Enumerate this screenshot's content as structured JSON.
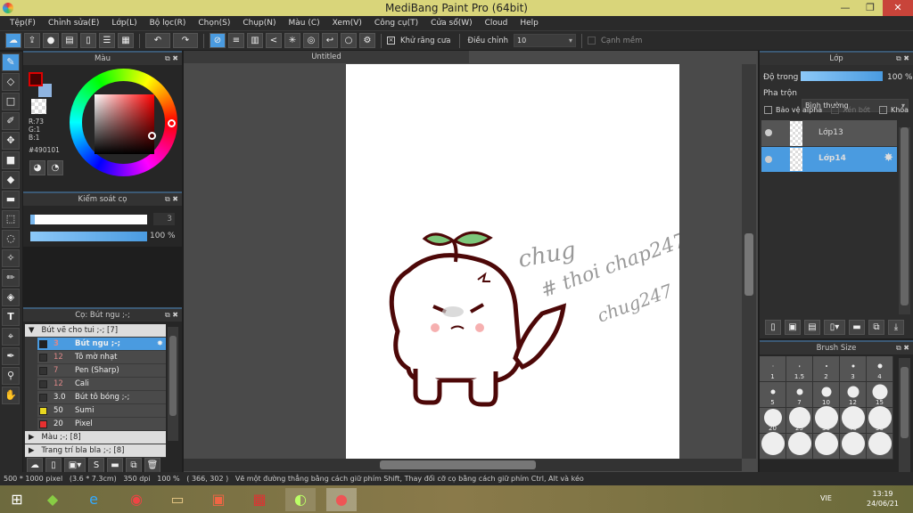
{
  "window": {
    "title": "MediBang Paint Pro (64bit)",
    "min": "—",
    "max": "❐",
    "close": "✕"
  },
  "menu": [
    "Tệp(F)",
    "Chỉnh sửa(E)",
    "Lớp(L)",
    "Bộ lọc(R)",
    "Chọn(S)",
    "Chụp(N)",
    "Màu (C)",
    "Xem(V)",
    "Công cụ(T)",
    "Cửa sổ(W)",
    "Cloud",
    "Help"
  ],
  "toolbar": {
    "antialias_label": "Khử răng cưa",
    "adjust_label": "Điều chỉnh",
    "adjust_value": "10",
    "soft_edge_label": "Cạnh mềm"
  },
  "color_panel": {
    "title": "Màu",
    "r": "R:73",
    "g": "G:1",
    "b": "B:1",
    "hex": "#490101",
    "primary": "#490101",
    "secondary": "#8fb4e0"
  },
  "brush_control": {
    "title": "Kiểm soát cọ",
    "size": "3",
    "opacity": "100 %",
    "opacity_value": 100
  },
  "brush_panel": {
    "title": "Cọ: Bút ngu ;-;",
    "groups": [
      {
        "label": "Bút vẽ cho tui ;-; [7]",
        "expanded": true
      },
      {
        "label": "Màu ;-; [8]",
        "expanded": false
      },
      {
        "label": "Trang trí bla bla ;-; [8]",
        "expanded": false
      }
    ],
    "brushes": [
      {
        "size": "3",
        "name": "Bút ngu ;-;",
        "color": "#222",
        "selected": true
      },
      {
        "size": "12",
        "name": "Tô mờ nhạt",
        "color": "#333"
      },
      {
        "size": "7",
        "name": "Pen (Sharp)",
        "color": "#333"
      },
      {
        "size": "12",
        "name": "Cali",
        "color": "#333"
      },
      {
        "size": "3.0",
        "name": "Bút tô bóng ;-;",
        "color": "#333"
      },
      {
        "size": "50",
        "name": "Sumi",
        "color": "#e8d820"
      },
      {
        "size": "20",
        "name": "Pixel",
        "color": "#e83030"
      }
    ]
  },
  "document": {
    "tab": "Untitled",
    "handwriting": [
      "chug",
      "# thoi chap247",
      "chug247"
    ]
  },
  "layer_panel": {
    "title": "Lớp",
    "opacity_label": "Độ trong",
    "opacity": "100 %",
    "opacity_value": 100,
    "blend_label": "Pha trộn",
    "blend_value": "Bình thường",
    "protect_alpha": "Bảo vệ alpha",
    "clipping": "Xén bớt",
    "lock": "Khóa",
    "layers": [
      {
        "name": "Lớp13",
        "selected": false
      },
      {
        "name": "Lớp14",
        "selected": true
      }
    ]
  },
  "brush_size_panel": {
    "title": "Brush Size",
    "sizes": [
      "1",
      "1.5",
      "2",
      "3",
      "4",
      "5",
      "7",
      "10",
      "12",
      "15",
      "20",
      "25",
      "30",
      "40",
      "50"
    ]
  },
  "status": {
    "text": "500 * 1000 pixel   (3.6 * 7.3cm)   350 dpi   100 %   ( 366, 302 )   Vẽ một đường thẳng bằng cách giữ phím Shift, Thay đổi cỡ cọ bằng cách giữ phím Ctrl, Alt và kéo"
  },
  "taskbar": {
    "lang": "VIE",
    "time": "13:19",
    "date": "24/06/21"
  }
}
